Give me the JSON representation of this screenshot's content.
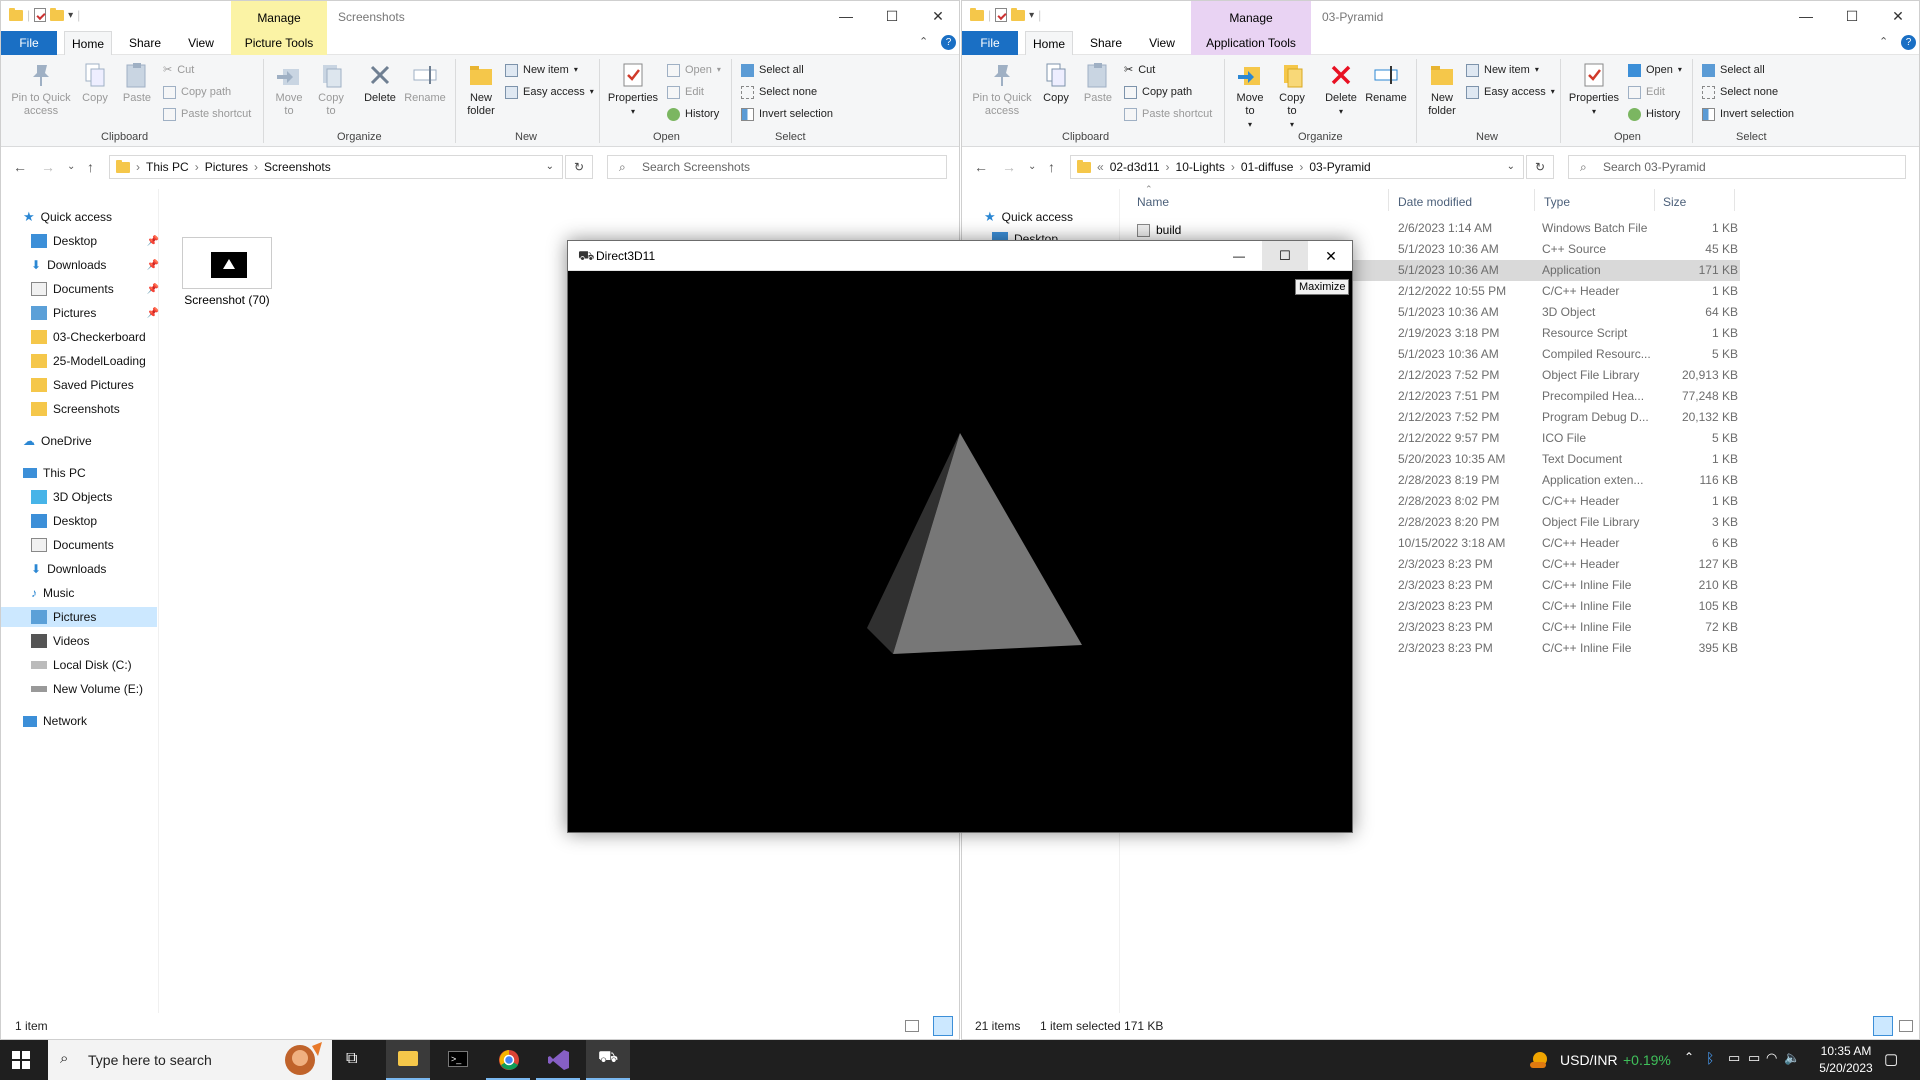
{
  "left_explorer": {
    "title": "Screenshots",
    "manage_tab": "Manage",
    "contextual_tab": "Picture Tools",
    "tabs": [
      "File",
      "Home",
      "Share",
      "View"
    ],
    "ribbon": {
      "pin": "Pin to Quick access",
      "copy": "Copy",
      "paste": "Paste",
      "cut": "Cut",
      "copy_path": "Copy path",
      "paste_shortcut": "Paste shortcut",
      "move_to": "Move to",
      "copy_to": "Copy to",
      "delete": "Delete",
      "rename": "Rename",
      "new_folder": "New folder",
      "new_item": "New item",
      "easy_access": "Easy access",
      "properties": "Properties",
      "open": "Open",
      "edit": "Edit",
      "history": "History",
      "select_all": "Select all",
      "select_none": "Select none",
      "invert_selection": "Invert selection",
      "groups": [
        "Clipboard",
        "Organize",
        "New",
        "Open",
        "Select"
      ]
    },
    "address": [
      "This PC",
      "Pictures",
      "Screenshots"
    ],
    "search_placeholder": "Search Screenshots",
    "nav": {
      "quick_access": "Quick access",
      "quick_items": [
        "Desktop",
        "Downloads",
        "Documents",
        "Pictures",
        "03-Checkerboard",
        "25-ModelLoading",
        "Saved Pictures",
        "Screenshots"
      ],
      "onedrive": "OneDrive",
      "this_pc": "This PC",
      "pc_items": [
        "3D Objects",
        "Desktop",
        "Documents",
        "Downloads",
        "Music",
        "Pictures",
        "Videos",
        "Local Disk (C:)",
        "New Volume (E:)"
      ],
      "network": "Network"
    },
    "file": "Screenshot (70)",
    "status": "1 item"
  },
  "right_explorer": {
    "title": "03-Pyramid",
    "manage_tab": "Manage",
    "contextual_tab": "Application Tools",
    "tabs": [
      "File",
      "Home",
      "Share",
      "View"
    ],
    "address": [
      "02-d3d11",
      "10-Lights",
      "01-diffuse",
      "03-Pyramid"
    ],
    "search_placeholder": "Search 03-Pyramid",
    "quick_access": "Quick access",
    "desktop": "Desktop",
    "columns": [
      "Name",
      "Date modified",
      "Type",
      "Size"
    ],
    "first_name": "build",
    "rows": [
      {
        "date": "2/6/2023 1:14 AM",
        "type": "Windows Batch File",
        "size": "1 KB"
      },
      {
        "date": "5/1/2023 10:36 AM",
        "type": "C++ Source",
        "size": "45 KB"
      },
      {
        "date": "5/1/2023 10:36 AM",
        "type": "Application",
        "size": "171 KB"
      },
      {
        "date": "2/12/2022 10:55 PM",
        "type": "C/C++ Header",
        "size": "1 KB"
      },
      {
        "date": "5/1/2023 10:36 AM",
        "type": "3D Object",
        "size": "64 KB"
      },
      {
        "date": "2/19/2023 3:18 PM",
        "type": "Resource Script",
        "size": "1 KB"
      },
      {
        "date": "5/1/2023 10:36 AM",
        "type": "Compiled Resourc...",
        "size": "5 KB"
      },
      {
        "date": "2/12/2023 7:52 PM",
        "type": "Object File Library",
        "size": "20,913 KB"
      },
      {
        "date": "2/12/2023 7:51 PM",
        "type": "Precompiled Hea...",
        "size": "77,248 KB"
      },
      {
        "date": "2/12/2023 7:52 PM",
        "type": "Program Debug D...",
        "size": "20,132 KB"
      },
      {
        "date": "2/12/2022 9:57 PM",
        "type": "ICO File",
        "size": "5 KB"
      },
      {
        "date": "5/20/2023 10:35 AM",
        "type": "Text Document",
        "size": "1 KB"
      },
      {
        "date": "2/28/2023 8:19 PM",
        "type": "Application exten...",
        "size": "116 KB"
      },
      {
        "date": "2/28/2023 8:02 PM",
        "type": "C/C++ Header",
        "size": "1 KB"
      },
      {
        "date": "2/28/2023 8:20 PM",
        "type": "Object File Library",
        "size": "3 KB"
      },
      {
        "date": "10/15/2022 3:18 AM",
        "type": "C/C++ Header",
        "size": "6 KB"
      },
      {
        "date": "2/3/2023 8:23 PM",
        "type": "C/C++ Header",
        "size": "127 KB"
      },
      {
        "date": "2/3/2023 8:23 PM",
        "type": "C/C++ Inline File",
        "size": "210 KB"
      },
      {
        "date": "2/3/2023 8:23 PM",
        "type": "C/C++ Inline File",
        "size": "105 KB"
      },
      {
        "date": "2/3/2023 8:23 PM",
        "type": "C/C++ Inline File",
        "size": "72 KB"
      },
      {
        "date": "2/3/2023 8:23 PM",
        "type": "C/C++ Inline File",
        "size": "395 KB"
      }
    ],
    "status_items": "21 items",
    "status_selected": "1 item selected  171 KB"
  },
  "d3d_window": {
    "title": "Direct3D11",
    "tooltip": "Maximize"
  },
  "taskbar": {
    "search_placeholder": "Type here to search",
    "ticker_symbol": "USD/INR",
    "ticker_change": "+0.19%",
    "time": "10:35 AM",
    "date": "5/20/2023"
  },
  "colors": {
    "accent": "#1a6fc4",
    "manage_left": "#fbf3a5",
    "manage_right": "#e9d3f3",
    "ticker_green": "#3fbf5a"
  }
}
